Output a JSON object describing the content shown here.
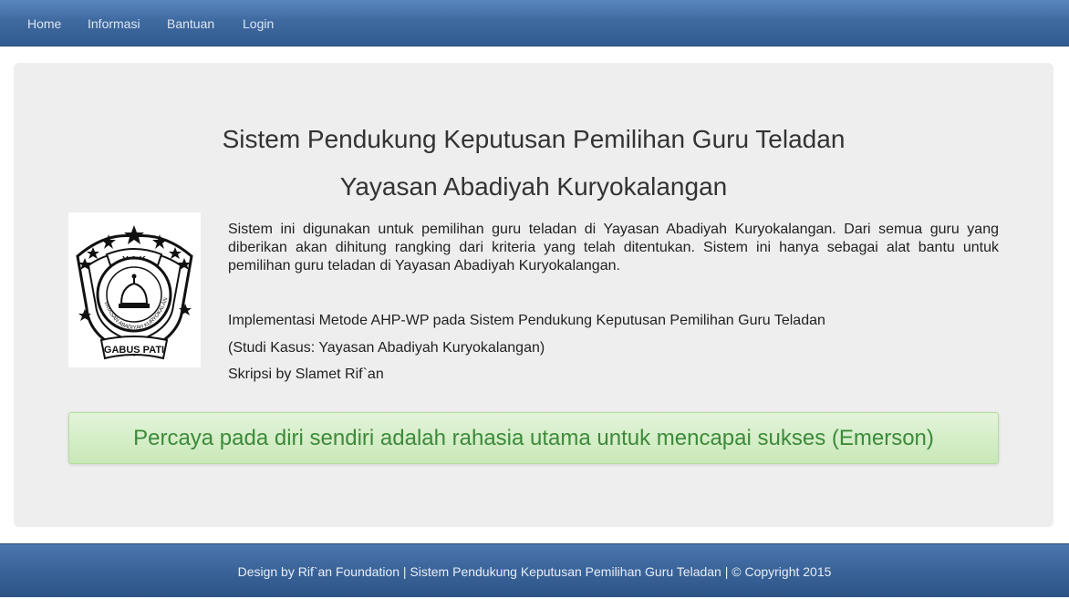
{
  "navbar": {
    "items": [
      {
        "label": "Home"
      },
      {
        "label": "Informasi"
      },
      {
        "label": "Bantuan"
      },
      {
        "label": "Login"
      }
    ]
  },
  "jumbotron": {
    "title_line1": "Sistem Pendukung Keputusan Pemilihan Guru Teladan",
    "title_line2": "Yayasan Abadiyah Kuryokalangan",
    "logo": {
      "top_text": "Y A K",
      "ring_text": "YAYASAN ABADIYAH KURYOKALANGAN",
      "banner_text": "GABUS PATI"
    },
    "description": "Sistem ini digunakan untuk pemilihan guru teladan di Yayasan Abadiyah Kuryokalangan. Dari semua guru yang diberikan akan dihitung rangking dari kriteria yang telah ditentukan. Sistem ini hanya sebagai alat bantu untuk pemilihan guru teladan di Yayasan Abadiyah Kuryokalangan.",
    "info_line1": "Implementasi Metode AHP-WP pada Sistem Pendukung Keputusan Pemilihan Guru Teladan",
    "info_line2": "(Studi Kasus: Yayasan Abadiyah Kuryokalangan)",
    "info_line3": "Skripsi by Slamet Rif`an",
    "quote": "Percaya pada diri sendiri adalah rahasia utama untuk mencapai sukses (Emerson)"
  },
  "footer": {
    "text": "Design by Rif`an Foundation | Sistem Pendukung Keputusan Pemilihan Guru Teladan | © Copyright 2015"
  },
  "colors": {
    "navbar": "#3f6aa0",
    "panel": "#eeeeee",
    "quote_text": "#3c8a3a",
    "quote_bg": "#d6eecb"
  }
}
